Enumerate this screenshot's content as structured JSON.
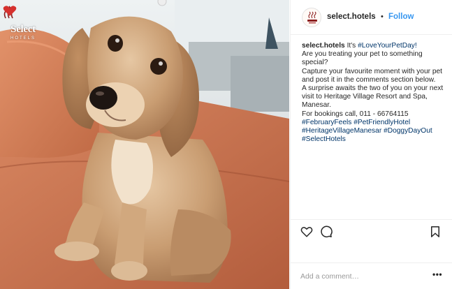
{
  "image": {
    "description": "Photo of a golden cocker spaniel puppy sitting on an orange cushion",
    "brand_overlay_name": "Select",
    "brand_overlay_sub": "HOTELS"
  },
  "header": {
    "username": "select.hotels",
    "separator": "•",
    "follow_label": "Follow"
  },
  "caption": {
    "username": "select.hotels",
    "intro": "It's ",
    "intro_tag": "#LoveYourPetDay!",
    "line_question": "Are you treating your pet to something special?",
    "line_capture": "Capture your favourite moment with your pet and post it in the comments section below.",
    "line_surprise": "A surprise awaits the two of you on your next visit to Heritage Village Resort and Spa, Manesar.",
    "line_bookings": "For bookings call, 011 - 66764115",
    "hashtags": [
      "#FebruaryFeels",
      "#PetFriendlyHotel",
      "#HeritageVillageManesar",
      "#DoggyDayOut",
      "#SelectHotels"
    ]
  },
  "actions": {
    "like_icon": "heart-outline-icon",
    "comment_icon": "speech-bubble-icon",
    "save_icon": "bookmark-icon"
  },
  "comment": {
    "placeholder": "Add a comment…",
    "more_label": "•••"
  },
  "colors": {
    "link": "#003569",
    "follow": "#3897f0",
    "border": "#efefef",
    "brand_red": "#d6312e"
  }
}
